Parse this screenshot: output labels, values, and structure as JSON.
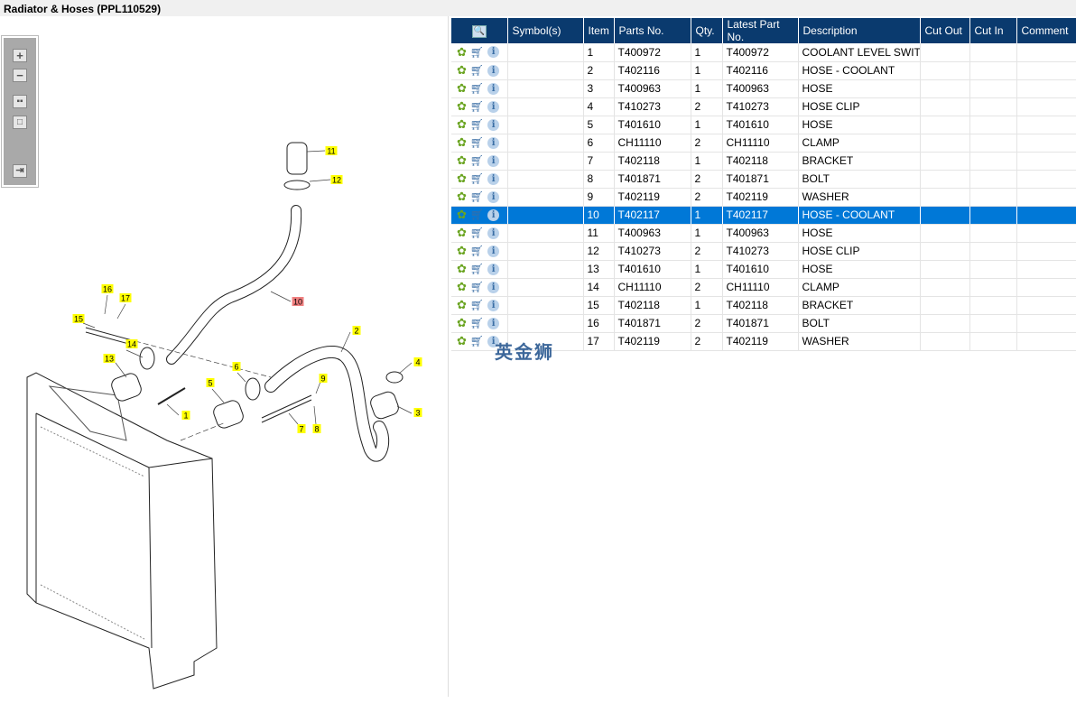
{
  "title": "Radiator & Hoses (PPL110529)",
  "toolbar": {
    "icons": [
      "zoom-in-icon",
      "zoom-out-icon",
      "fit-all-icon",
      "actual-size-icon",
      "export-icon"
    ]
  },
  "watermark": "英金狮",
  "diagram": {
    "callouts": [
      "11",
      "12",
      "10",
      "16",
      "17",
      "15",
      "14",
      "13",
      "2",
      "4",
      "6",
      "5",
      "9",
      "3",
      "1",
      "7",
      "8"
    ],
    "highlighted": "10"
  },
  "table": {
    "columns": [
      "",
      "Symbol(s)",
      "Item",
      "Parts No.",
      "Qty.",
      "Latest Part No.",
      "Description",
      "Cut Out",
      "Cut In",
      "Comment"
    ],
    "selected_item": "10",
    "rows": [
      {
        "item": "1",
        "part": "T400972",
        "qty": "1",
        "latest": "T400972",
        "desc": "COOLANT LEVEL SWITCH"
      },
      {
        "item": "2",
        "part": "T402116",
        "qty": "1",
        "latest": "T402116",
        "desc": "HOSE - COOLANT"
      },
      {
        "item": "3",
        "part": "T400963",
        "qty": "1",
        "latest": "T400963",
        "desc": "HOSE"
      },
      {
        "item": "4",
        "part": "T410273",
        "qty": "2",
        "latest": "T410273",
        "desc": "HOSE CLIP"
      },
      {
        "item": "5",
        "part": "T401610",
        "qty": "1",
        "latest": "T401610",
        "desc": "HOSE"
      },
      {
        "item": "6",
        "part": "CH11110",
        "qty": "2",
        "latest": "CH11110",
        "desc": "CLAMP"
      },
      {
        "item": "7",
        "part": "T402118",
        "qty": "1",
        "latest": "T402118",
        "desc": "BRACKET"
      },
      {
        "item": "8",
        "part": "T401871",
        "qty": "2",
        "latest": "T401871",
        "desc": "BOLT"
      },
      {
        "item": "9",
        "part": "T402119",
        "qty": "2",
        "latest": "T402119",
        "desc": "WASHER"
      },
      {
        "item": "10",
        "part": "T402117",
        "qty": "1",
        "latest": "T402117",
        "desc": "HOSE - COOLANT"
      },
      {
        "item": "11",
        "part": "T400963",
        "qty": "1",
        "latest": "T400963",
        "desc": "HOSE"
      },
      {
        "item": "12",
        "part": "T410273",
        "qty": "2",
        "latest": "T410273",
        "desc": "HOSE CLIP"
      },
      {
        "item": "13",
        "part": "T401610",
        "qty": "1",
        "latest": "T401610",
        "desc": "HOSE"
      },
      {
        "item": "14",
        "part": "CH11110",
        "qty": "2",
        "latest": "CH11110",
        "desc": "CLAMP"
      },
      {
        "item": "15",
        "part": "T402118",
        "qty": "1",
        "latest": "T402118",
        "desc": "BRACKET"
      },
      {
        "item": "16",
        "part": "T401871",
        "qty": "2",
        "latest": "T401871",
        "desc": "BOLT"
      },
      {
        "item": "17",
        "part": "T402119",
        "qty": "2",
        "latest": "T402119",
        "desc": "WASHER"
      }
    ]
  }
}
